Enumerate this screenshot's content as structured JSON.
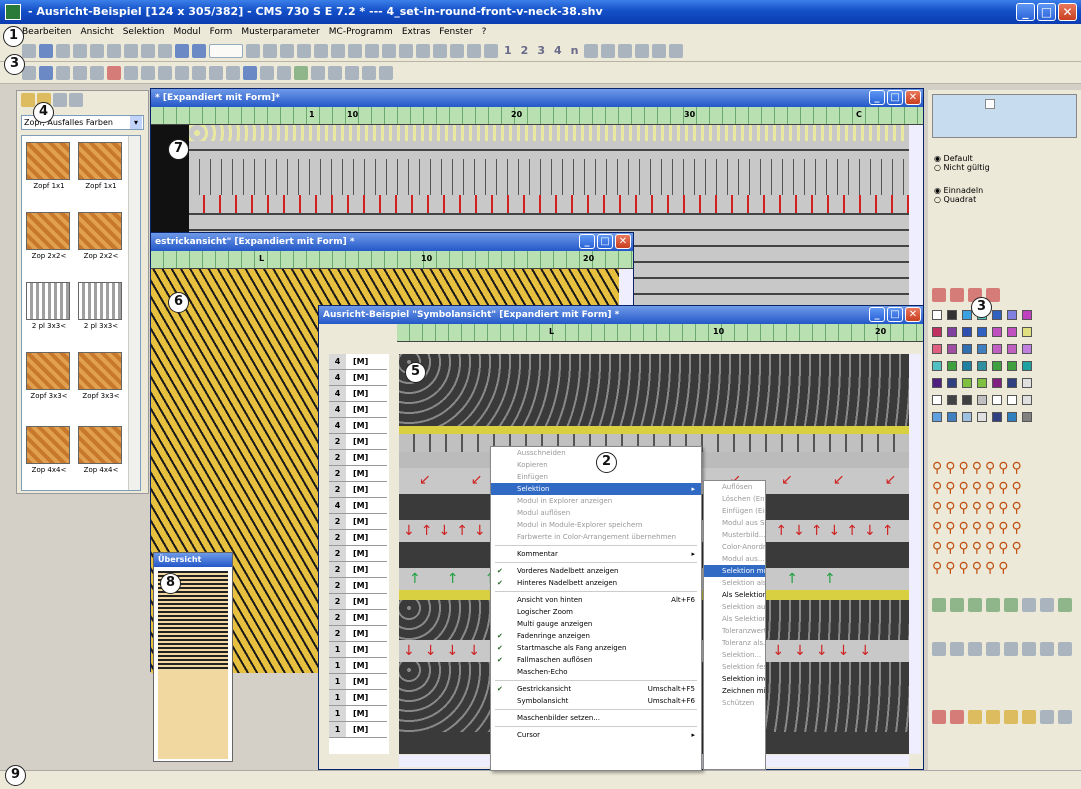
{
  "app": {
    "title": "- Ausricht-Beispiel [124 x 305/382] - CMS 730 S E 7.2 * --- 4_set-in-round-front-v-neck-38.shv"
  },
  "menu": [
    "Bearbeiten",
    "Ansicht",
    "Selektion",
    "Modul",
    "Form",
    "Musterparameter",
    "MC-Programm",
    "Extras",
    "Fenster",
    "?"
  ],
  "toolbar1": {
    "numbers": [
      "1",
      "2",
      "3",
      "4",
      "n"
    ]
  },
  "windows": {
    "form": {
      "title": "* [Expandiert mit Form]*"
    },
    "strick": {
      "title": "estrickansicht\" [Expandiert mit Form] *"
    },
    "symbol": {
      "title": "Ausricht-Beispiel \"Symbolansicht\" [Expandiert mit Form] *"
    },
    "overview": {
      "title": "Übersicht"
    }
  },
  "left_panel": {
    "dropdown": "Zopf, Ausfalles Farben",
    "thumbs": [
      "Zopf 1x1",
      "Zopf 1x1",
      "Zop 2x2<",
      "Zop 2x2<",
      "2 pl 3x3<",
      "2 pl 3x3<",
      "Zopf 3x3<",
      "Zopf 3x3<",
      "Zop 4x4<",
      "Zop 4x4<"
    ]
  },
  "right_panel": {
    "radio_a": [
      "Default",
      "Nicht gültig"
    ],
    "radio_b": [
      "Einnadeln",
      "Quadrat"
    ]
  },
  "ruler_marks": {
    "form": [
      "1",
      "10",
      "20",
      "30",
      "C"
    ],
    "strick": [
      "L",
      "10",
      "20"
    ],
    "symbol": [
      "L",
      "10",
      "20"
    ]
  },
  "row_headers": [
    {
      "n": "4",
      "l": "[M]"
    },
    {
      "n": "4",
      "l": "[M]"
    },
    {
      "n": "4",
      "l": "[M]"
    },
    {
      "n": "4",
      "l": "[M]"
    },
    {
      "n": "4",
      "l": "[M]"
    },
    {
      "n": "2",
      "l": "[M]"
    },
    {
      "n": "2",
      "l": "[M]"
    },
    {
      "n": "2",
      "l": "[M]"
    },
    {
      "n": "2",
      "l": "[M]"
    },
    {
      "n": "4",
      "l": "[M]"
    },
    {
      "n": "2",
      "l": "[M]"
    },
    {
      "n": "2",
      "l": "[M]"
    },
    {
      "n": "2",
      "l": "[M]"
    },
    {
      "n": "2",
      "l": "[M]"
    },
    {
      "n": "2",
      "l": "[M]"
    },
    {
      "n": "2",
      "l": "[M]"
    },
    {
      "n": "2",
      "l": "[M]"
    },
    {
      "n": "2",
      "l": "[M]"
    },
    {
      "n": "1",
      "l": "[M]"
    },
    {
      "n": "1",
      "l": "[M]"
    },
    {
      "n": "1",
      "l": "[M]"
    },
    {
      "n": "1",
      "l": "[M]"
    },
    {
      "n": "1",
      "l": "[M]"
    },
    {
      "n": "1",
      "l": "[M]"
    }
  ],
  "context_menu": [
    {
      "label": "Ausschneiden",
      "dis": true
    },
    {
      "label": "Kopieren",
      "dis": true
    },
    {
      "label": "Einfügen",
      "dis": true
    },
    {
      "label": "Selektion",
      "sub": true,
      "sel": true
    },
    {
      "label": "Modul in Explorer anzeigen",
      "dis": true
    },
    {
      "label": "Modul auflösen",
      "dis": true
    },
    {
      "label": "Modul in Module-Explorer speichern",
      "dis": true
    },
    {
      "label": "Farbwerte in Color-Arrangement übernehmen",
      "dis": true
    },
    {
      "sep": true
    },
    {
      "label": "Kommentar",
      "sub": true
    },
    {
      "sep": true
    },
    {
      "label": "Vorderes Nadelbett anzeigen",
      "chk": true
    },
    {
      "label": "Hinteres Nadelbett anzeigen",
      "chk": true
    },
    {
      "sep": true
    },
    {
      "label": "Ansicht von hinten",
      "sc": "Alt+F6"
    },
    {
      "label": "Logischer Zoom"
    },
    {
      "label": "Multi gauge anzeigen"
    },
    {
      "label": "Fadenringe anzeigen",
      "chk": true
    },
    {
      "label": "Startmasche als Fang anzeigen",
      "chk": true
    },
    {
      "label": "Fallmaschen auflösen",
      "chk": true
    },
    {
      "label": "Maschen-Echo"
    },
    {
      "sep": true
    },
    {
      "label": "Gestrickansicht",
      "sc": "Umschalt+F5",
      "chk": true
    },
    {
      "label": "Symbolansicht",
      "sc": "Umschalt+F6"
    },
    {
      "sep": true
    },
    {
      "label": "Maschenbilder setzen..."
    },
    {
      "sep": true
    },
    {
      "label": "Cursor",
      "sub": true
    }
  ],
  "submenu": [
    {
      "label": "Auflösen",
      "en": false
    },
    {
      "label": "Löschen (Entf)",
      "en": false
    },
    {
      "label": "Einfügen (Einf)",
      "en": false
    },
    {
      "label": "Modul aus Selektion",
      "en": false
    },
    {
      "label": "Musterbild...",
      "en": false
    },
    {
      "label": "Color-Anordnung",
      "en": false
    },
    {
      "label": "Modul aus...",
      "en": false
    },
    {
      "label": "Selektion mod...",
      "sel": true
    },
    {
      "label": "Selektion als...",
      "en": false
    },
    {
      "label": "Als Selektion...",
      "en": true
    },
    {
      "label": "Selektion aufl...",
      "en": false
    },
    {
      "label": "Als Selektion...",
      "en": false
    },
    {
      "label": "Toleranzwert...",
      "en": false
    },
    {
      "label": "Toleranz als...",
      "en": false
    },
    {
      "label": "Selektion...",
      "en": false
    },
    {
      "label": "Selektion fest...",
      "en": false
    },
    {
      "label": "Selektion inv...",
      "en": true
    },
    {
      "label": "Zeichnen mit...",
      "en": true
    },
    {
      "label": "Schützen",
      "en": false
    }
  ],
  "callouts": [
    "1",
    "2",
    "3",
    "3",
    "4",
    "5",
    "6",
    "7",
    "8",
    "9"
  ],
  "colors": {
    "xp_blue": "#2458c8",
    "ruler_green": "#b8e0b0",
    "knit_yellow": "#e8c040",
    "symbol_dark": "#3a3a3a",
    "red_arrow": "#d02020",
    "green_arrow": "#20a040",
    "menu_select": "#316ac5"
  }
}
